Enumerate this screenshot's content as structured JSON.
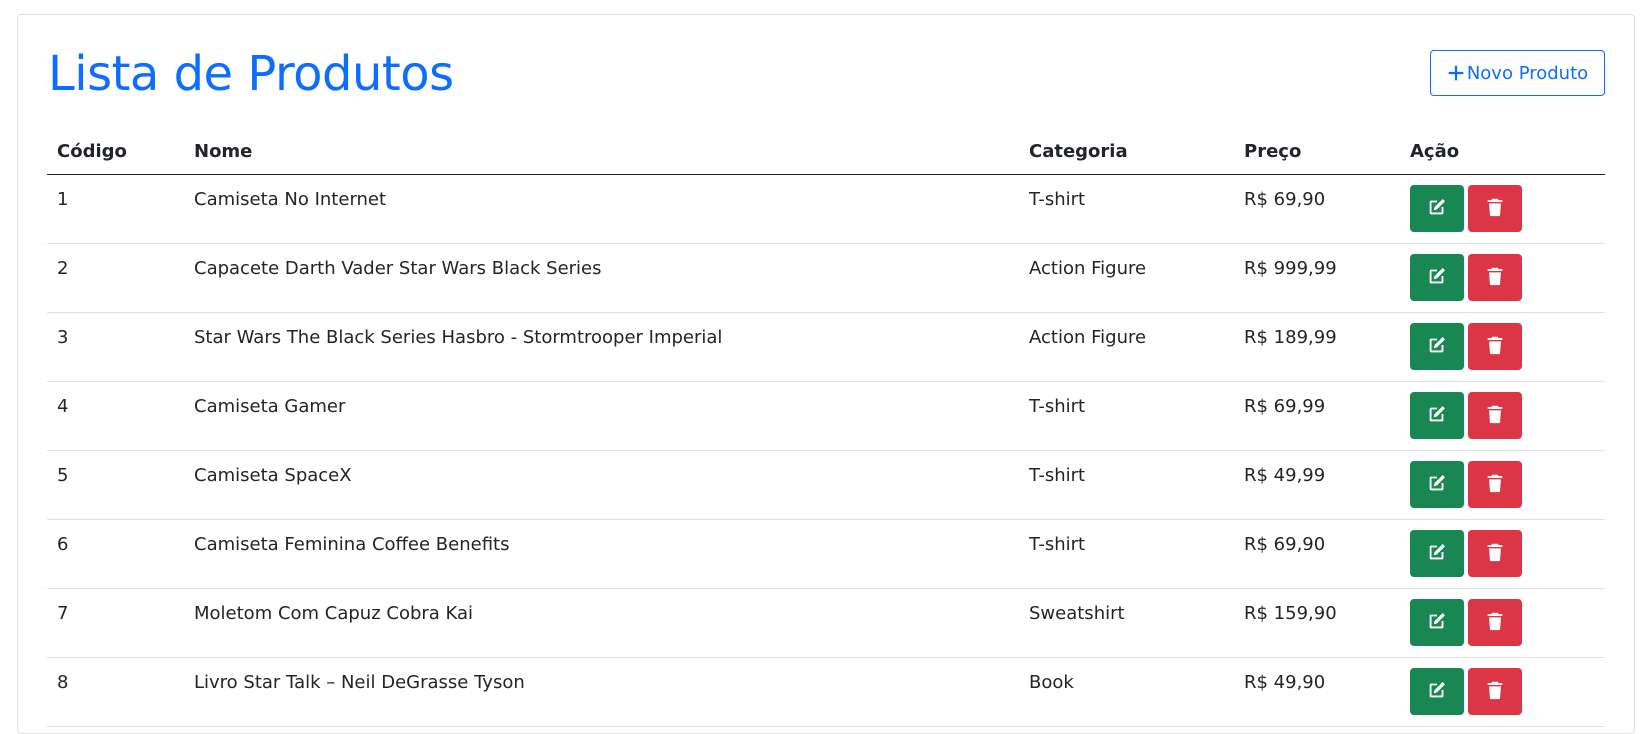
{
  "header": {
    "title": "Lista de Produtos",
    "new_button_label": "Novo Produto",
    "new_button_icon": "plus-icon"
  },
  "colors": {
    "primary": "#0d6efd",
    "edit": "#198754",
    "delete": "#dc3545"
  },
  "table": {
    "columns": [
      "Código",
      "Nome",
      "Categoria",
      "Preço",
      "Ação"
    ],
    "rows": [
      {
        "code": "1",
        "name": "Camiseta No Internet",
        "category": "T-shirt",
        "price": "R$ 69,90"
      },
      {
        "code": "2",
        "name": "Capacete Darth Vader Star Wars Black Series",
        "category": "Action Figure",
        "price": "R$ 999,99"
      },
      {
        "code": "3",
        "name": "Star Wars The Black Series Hasbro - Stormtrooper Imperial",
        "category": "Action Figure",
        "price": "R$ 189,99"
      },
      {
        "code": "4",
        "name": "Camiseta Gamer",
        "category": "T-shirt",
        "price": "R$ 69,99"
      },
      {
        "code": "5",
        "name": "Camiseta SpaceX",
        "category": "T-shirt",
        "price": "R$ 49,99"
      },
      {
        "code": "6",
        "name": "Camiseta Feminina Coffee Benefits",
        "category": "T-shirt",
        "price": "R$ 69,90"
      },
      {
        "code": "7",
        "name": "Moletom Com Capuz Cobra Kai",
        "category": "Sweatshirt",
        "price": "R$ 159,90"
      },
      {
        "code": "8",
        "name": "Livro Star Talk – Neil DeGrasse Tyson",
        "category": "Book",
        "price": "R$ 49,90"
      }
    ],
    "row_action_icons": [
      "edit-icon",
      "trash-icon"
    ]
  }
}
